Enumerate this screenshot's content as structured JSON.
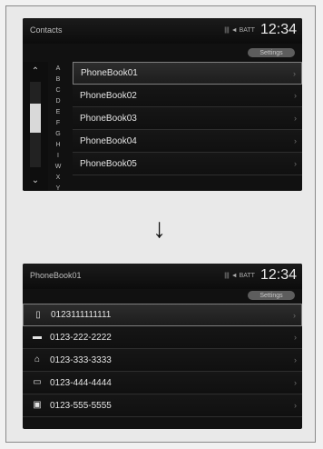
{
  "screen1": {
    "title": "Contacts",
    "status": "||| ◄ BATT",
    "clock": "12:34",
    "pill": "Settings",
    "index_letters": [
      "A",
      "B",
      "C",
      "D",
      "E",
      "F",
      "G",
      "H",
      "I",
      "W",
      "X",
      "Y"
    ],
    "scroll_fraction": {
      "start": 0.25,
      "size": 0.35
    },
    "rows": [
      {
        "label": "PhoneBook01"
      },
      {
        "label": "PhoneBook02"
      },
      {
        "label": "PhoneBook03"
      },
      {
        "label": "PhoneBook04"
      },
      {
        "label": "PhoneBook05"
      }
    ],
    "selected_index": 0
  },
  "screen2": {
    "title": "PhoneBook01",
    "status": "||| ◄ BATT",
    "clock": "12:34",
    "pill": "Settings",
    "rows": [
      {
        "label": "0123111111111",
        "icon": "mobile-phone-icon",
        "glyph": "▯"
      },
      {
        "label": "0123-222-2222",
        "icon": "work-phone-icon",
        "glyph": "▬"
      },
      {
        "label": "0123-333-3333",
        "icon": "home-icon",
        "glyph": "⌂"
      },
      {
        "label": "0123-444-4444",
        "icon": "fax-icon",
        "glyph": "▭"
      },
      {
        "label": "0123-555-5555",
        "icon": "other-phone-icon",
        "glyph": "▣"
      }
    ],
    "selected_index": 0
  },
  "arrow": "↓"
}
